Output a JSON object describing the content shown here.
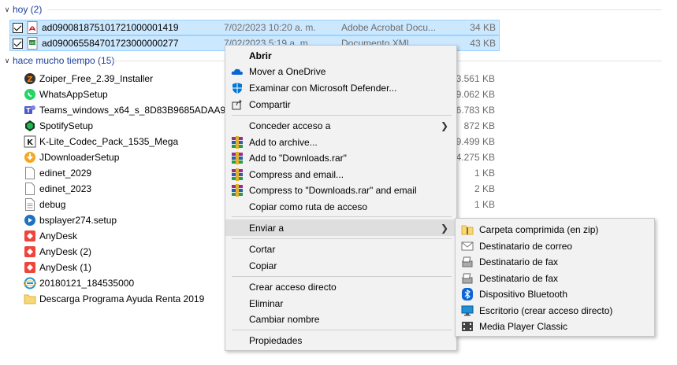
{
  "groups": [
    {
      "label": "hoy (2)"
    },
    {
      "label": "hace mucho tiempo (15)"
    }
  ],
  "today_files": [
    {
      "name": "ad090081875101721000001419",
      "date": "7/02/2023 10:20 a. m.",
      "type": "Adobe Acrobat Docu...",
      "size": "34 KB",
      "icon": "pdf-icon"
    },
    {
      "name": "ad090065584701723000000277",
      "date": "7/02/2023 5:19 a. m.",
      "type": "Documento XML",
      "size": "43 KB",
      "icon": "xml-icon"
    }
  ],
  "old_files": [
    {
      "name": "Zoiper_Free_2.39_Installer",
      "size": "3.561 KB",
      "icon": "zoiper-icon"
    },
    {
      "name": "WhatsAppSetup",
      "size": "149.062 KB",
      "icon": "whatsapp-icon"
    },
    {
      "name": "Teams_windows_x64_s_8D83B9685ADAA9D-...",
      "size": "96.783 KB",
      "icon": "teams-icon"
    },
    {
      "name": "SpotifySetup",
      "size": "872 KB",
      "icon": "spotify-icon"
    },
    {
      "name": "K-Lite_Codec_Pack_1535_Mega",
      "size": "59.499 KB",
      "icon": "klite-icon"
    },
    {
      "name": "JDownloaderSetup",
      "size": "44.275 KB",
      "icon": "jdownloader-icon"
    },
    {
      "name": "edinet_2029",
      "size": "1 KB",
      "icon": "file-icon"
    },
    {
      "name": "edinet_2023",
      "size": "2 KB",
      "icon": "file-icon"
    },
    {
      "name": "debug",
      "size": "1 KB",
      "icon": "text-file-icon"
    },
    {
      "name": "bsplayer274.setup",
      "size": "",
      "icon": "bsplayer-icon"
    },
    {
      "name": "AnyDesk",
      "size": "",
      "icon": "anydesk-icon"
    },
    {
      "name": "AnyDesk (2)",
      "size": "",
      "icon": "anydesk-icon"
    },
    {
      "name": "AnyDesk (1)",
      "size": "",
      "icon": "anydesk-icon"
    },
    {
      "name": "20180121_184535000",
      "size": "",
      "icon": "ie-icon"
    },
    {
      "name": "Descarga Programa Ayuda Renta 2019",
      "size": "",
      "icon": "folder-icon"
    }
  ],
  "context_menu": {
    "items": [
      {
        "label": "Abrir",
        "icon": ""
      },
      {
        "label": "Mover a OneDrive",
        "icon": "onedrive-icon"
      },
      {
        "label": "Examinar con Microsoft Defender...",
        "icon": "defender-icon"
      },
      {
        "label": "Compartir",
        "icon": "share-icon"
      },
      {
        "label": "Conceder acceso a",
        "icon": ""
      },
      {
        "label": "Add to archive...",
        "icon": "winrar-icon"
      },
      {
        "label": "Add to \"Downloads.rar\"",
        "icon": "winrar-icon"
      },
      {
        "label": "Compress and email...",
        "icon": "winrar-icon"
      },
      {
        "label": "Compress to \"Downloads.rar\" and email",
        "icon": "winrar-icon"
      },
      {
        "label": "Copiar como ruta de acceso",
        "icon": ""
      },
      {
        "label": "Enviar a",
        "icon": ""
      },
      {
        "label": "Cortar",
        "icon": ""
      },
      {
        "label": "Copiar",
        "icon": ""
      },
      {
        "label": "Crear acceso directo",
        "icon": ""
      },
      {
        "label": "Eliminar",
        "icon": ""
      },
      {
        "label": "Cambiar nombre",
        "icon": ""
      },
      {
        "label": "Propiedades",
        "icon": ""
      }
    ]
  },
  "send_to_menu": {
    "items": [
      {
        "label": "Carpeta comprimida (en zip)",
        "icon": "zip-folder-icon"
      },
      {
        "label": "Destinatario de correo",
        "icon": "mail-icon"
      },
      {
        "label": "Destinatario de fax",
        "icon": "fax-icon"
      },
      {
        "label": "Destinatario de fax",
        "icon": "fax-icon"
      },
      {
        "label": "Dispositivo Bluetooth",
        "icon": "bluetooth-icon"
      },
      {
        "label": "Escritorio (crear acceso directo)",
        "icon": "desktop-icon"
      },
      {
        "label": "Media Player Classic",
        "icon": "mpc-icon"
      }
    ]
  },
  "colors": {
    "selection_bg": "#cce8ff",
    "selection_border": "#99d1ff",
    "group_header": "#1f3f9a",
    "menu_bg": "#f2f2f2"
  }
}
